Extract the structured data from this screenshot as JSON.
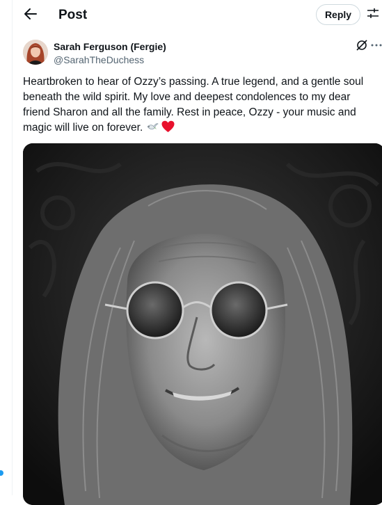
{
  "header": {
    "title": "Post",
    "reply_label": "Reply",
    "back_icon": "arrow-left-icon",
    "settings_icon": "sliders-icon"
  },
  "post": {
    "author_name": "Sarah Ferguson (Fergie)",
    "author_handle": "@SarahTheDuchess",
    "text": "Heartbroken to hear of Ozzy’s passing. A true legend, and a gentle soul beneath the wild spirit. My love and deepest condolences to my dear friend Sharon and all the family. Rest in peace, Ozzy - your music and magic will live on forever.",
    "emojis": [
      "dove-icon",
      "red-heart-icon"
    ],
    "image_icon": "portrait-photo"
  },
  "colors": {
    "text": "#0f1419",
    "secondary": "#536471",
    "border": "#cfd9de",
    "accent": "#1d9bf0",
    "heart": "#f4212e"
  }
}
